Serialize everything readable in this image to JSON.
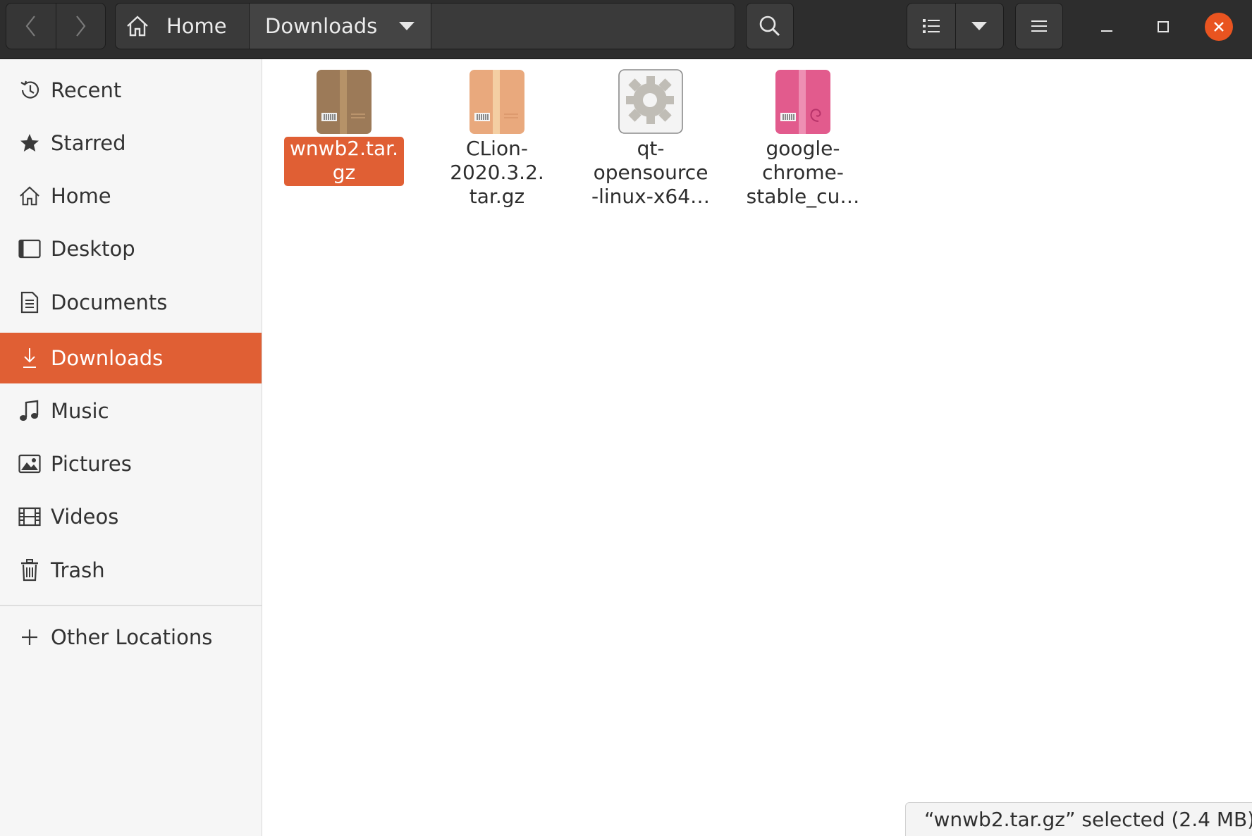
{
  "header": {
    "path": [
      {
        "label": "Home",
        "icon": "home-icon"
      },
      {
        "label": "Downloads",
        "icon": "chevron-down-icon"
      }
    ],
    "buttons": [
      "back-icon",
      "forward-icon",
      "search-icon",
      "list-view-icon",
      "view-options-icon",
      "hamburger-menu-icon"
    ],
    "window_controls": [
      "minimize-icon",
      "maximize-icon",
      "close-icon"
    ]
  },
  "sidebar": {
    "items": [
      {
        "label": "Recent",
        "icon": "clock-icon"
      },
      {
        "label": "Starred",
        "icon": "star-icon"
      },
      {
        "label": "Home",
        "icon": "home-icon"
      },
      {
        "label": "Desktop",
        "icon": "desktop-icon"
      },
      {
        "label": "Documents",
        "icon": "document-icon"
      },
      {
        "label": "Downloads",
        "icon": "download-icon",
        "active": true
      },
      {
        "label": "Music",
        "icon": "music-note-icon"
      },
      {
        "label": "Pictures",
        "icon": "picture-icon"
      },
      {
        "label": "Videos",
        "icon": "film-icon"
      },
      {
        "label": "Trash",
        "icon": "trash-icon"
      }
    ],
    "other_locations": {
      "label": "Other Locations",
      "icon": "plus-icon"
    }
  },
  "files": [
    {
      "name": "wnwb2.tar.\ngz",
      "icon": "archive-brown-icon",
      "selected": true
    },
    {
      "name": "CLion-\n2020.3.2.\ntar.gz",
      "icon": "archive-tan-icon",
      "selected": false
    },
    {
      "name": "qt-\nopensource\n-linux-x64…",
      "icon": "executable-gear-icon",
      "selected": false
    },
    {
      "name": "google-\nchrome-\nstable_cu…",
      "icon": "debian-package-icon",
      "selected": false
    }
  ],
  "status": {
    "text": "“wnwb2.tar.gz” selected  (2.4 MB)"
  },
  "colors": {
    "accent": "#e05f34",
    "header_bg": "#2d2d2d",
    "sidebar_bg": "#f6f6f6",
    "close_button": "#e95420"
  }
}
